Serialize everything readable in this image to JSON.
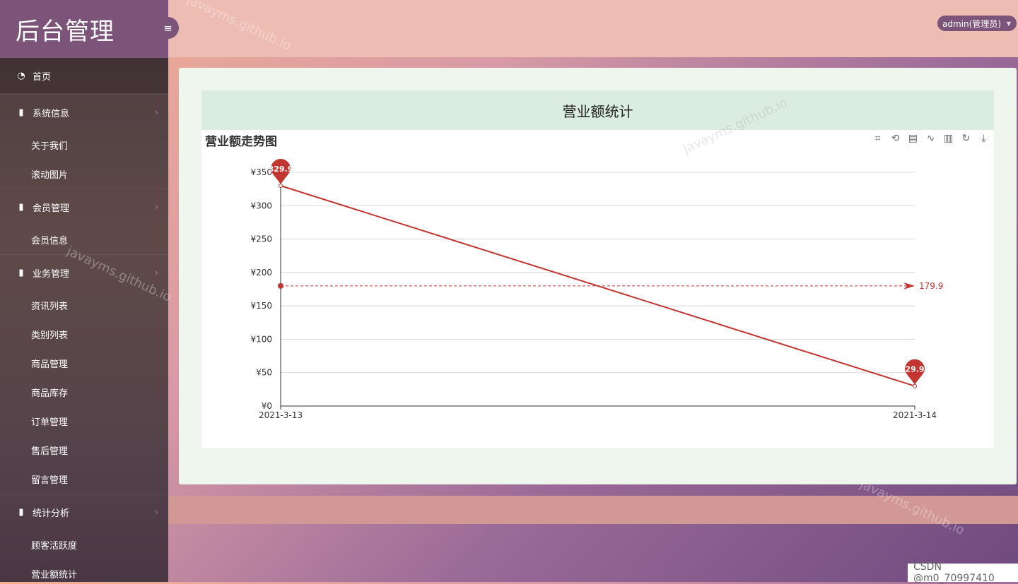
{
  "brand": {
    "title": "后台管理"
  },
  "header": {
    "user_label": "admin(管理员)"
  },
  "sidebar": {
    "home": "首页",
    "groups": [
      {
        "label": "系统信息",
        "items": [
          "关于我们",
          "滚动图片"
        ]
      },
      {
        "label": "会员管理",
        "items": [
          "会员信息"
        ]
      },
      {
        "label": "业务管理",
        "items": [
          "资讯列表",
          "类别列表",
          "商品管理",
          "商品库存",
          "订单管理",
          "售后管理",
          "留言管理"
        ]
      },
      {
        "label": "统计分析",
        "items": [
          "顾客活跃度",
          "营业额统计"
        ]
      }
    ]
  },
  "main": {
    "panel_title": "营业额统计"
  },
  "toolbox": [
    "zoom-icon",
    "zoom-reset-icon",
    "data-view-icon",
    "line-switch-icon",
    "bar-switch-icon",
    "restore-icon",
    "save-image-icon"
  ],
  "chart_data": {
    "type": "line",
    "title": "营业额走势图",
    "categories": [
      "2021-3-13",
      "2021-3-14"
    ],
    "series": [
      {
        "values": [
          329.9,
          29.9
        ],
        "color": "#c23531"
      }
    ],
    "yticks": [
      "¥0",
      "¥50",
      "¥100",
      "¥150",
      "¥200",
      "¥250",
      "¥300",
      "¥350"
    ],
    "ylim": [
      0,
      350
    ],
    "grid": true,
    "mark_points": [
      {
        "label": "329.9",
        "category": "2021-3-13",
        "value": 329.9
      },
      {
        "label": "29.9",
        "category": "2021-3-14",
        "value": 29.9
      }
    ],
    "mark_line": {
      "label": "179.9",
      "value": 179.9
    }
  },
  "watermark": "javayms.github.io",
  "footer": {
    "credit": "CSDN @m0_70997410"
  }
}
